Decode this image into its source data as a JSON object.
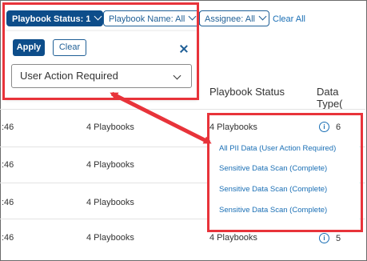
{
  "filters": {
    "playbook_status": "Playbook Status: 1",
    "playbook_name": "Playbook Name: All",
    "assignee": "Assignee: All",
    "clear_all": "Clear All"
  },
  "panel": {
    "apply_label": "Apply",
    "clear_label": "Clear",
    "selected_value": "User Action Required"
  },
  "table": {
    "headers": {
      "playbook_status": "Playbook Status",
      "data_type": "Data Type("
    },
    "rows": [
      {
        "time": ":46",
        "playbooks": "4 Playbooks",
        "status": "4 Playbooks",
        "count": "6"
      },
      {
        "time": ":46",
        "playbooks": "4 Playbooks"
      },
      {
        "time": ":46",
        "playbooks": "4 Playbooks"
      },
      {
        "time": ":46",
        "playbooks": "4 Playbooks"
      },
      {
        "time": ":46",
        "playbooks": "4 Playbooks",
        "status": "4 Playbooks",
        "count": "5"
      }
    ]
  },
  "popup": {
    "items": [
      "All PII Data  (User Action Required)",
      "Sensitive Data Scan  (Complete)",
      "Sensitive Data Scan  (Complete)",
      "Sensitive Data Scan  (Complete)"
    ]
  },
  "colors": {
    "accent": "#0d4d8a",
    "link": "#1a6fb5",
    "annotation": "#e8333a"
  }
}
